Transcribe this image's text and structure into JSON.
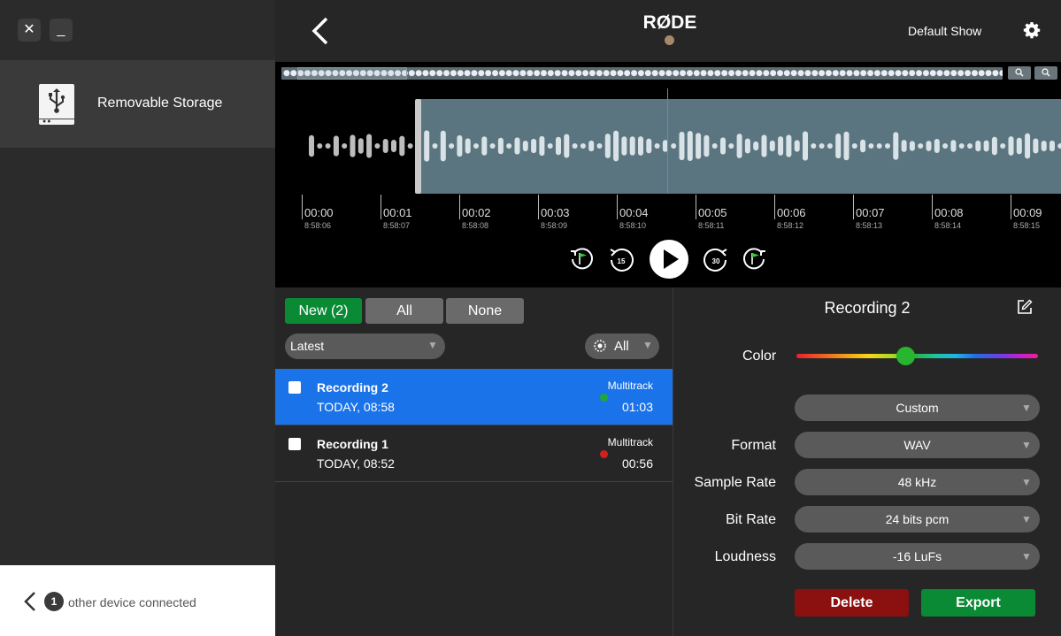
{
  "window": {
    "close_glyph": "✕",
    "minimize_glyph": "_"
  },
  "sidebar": {
    "device": {
      "label": "Removable Storage",
      "icon": "usb-drive-icon"
    },
    "footer": {
      "count": "1",
      "text": "other device connected"
    }
  },
  "header": {
    "logo": "RØDE",
    "show_name": "Default Show"
  },
  "timeline": {
    "ticks": [
      {
        "time": "00:00",
        "clock": "8:58:06"
      },
      {
        "time": "00:01",
        "clock": "8:58:07"
      },
      {
        "time": "00:02",
        "clock": "8:58:08"
      },
      {
        "time": "00:03",
        "clock": "8:58:09"
      },
      {
        "time": "00:04",
        "clock": "8:58:10"
      },
      {
        "time": "00:05",
        "clock": "8:58:11"
      },
      {
        "time": "00:06",
        "clock": "8:58:12"
      },
      {
        "time": "00:07",
        "clock": "8:58:13"
      },
      {
        "time": "00:08",
        "clock": "8:58:14"
      },
      {
        "time": "00:09",
        "clock": "8:58:15"
      }
    ],
    "skip_back_label": "15",
    "skip_forward_label": "30"
  },
  "filters": {
    "new_label": "New (2)",
    "all_label": "All",
    "none_label": "None"
  },
  "sort": {
    "value": "Latest"
  },
  "device_filter": {
    "value": "All"
  },
  "recordings": [
    {
      "name": "Recording 2",
      "date": "TODAY, 08:58",
      "type": "Multitrack",
      "duration": "01:03",
      "dot_color": "#1ea83a",
      "selected": true
    },
    {
      "name": "Recording 1",
      "date": "TODAY, 08:52",
      "type": "Multitrack",
      "duration": "00:56",
      "dot_color": "#d02020",
      "selected": false
    }
  ],
  "detail": {
    "title": "Recording 2",
    "color_label": "Color",
    "color_value": "#28b52f",
    "preset": "Custom",
    "format_label": "Format",
    "format": "WAV",
    "sample_rate_label": "Sample Rate",
    "sample_rate": "48 kHz",
    "bit_rate_label": "Bit Rate",
    "bit_rate": "24 bits pcm",
    "loudness_label": "Loudness",
    "loudness": "-16 LuFs",
    "delete_label": "Delete",
    "export_label": "Export"
  },
  "colors": {
    "accent_blue": "#1a73e8",
    "green": "#0a8a35",
    "delete_red": "#8b1010",
    "export_green": "#0a8a35"
  }
}
